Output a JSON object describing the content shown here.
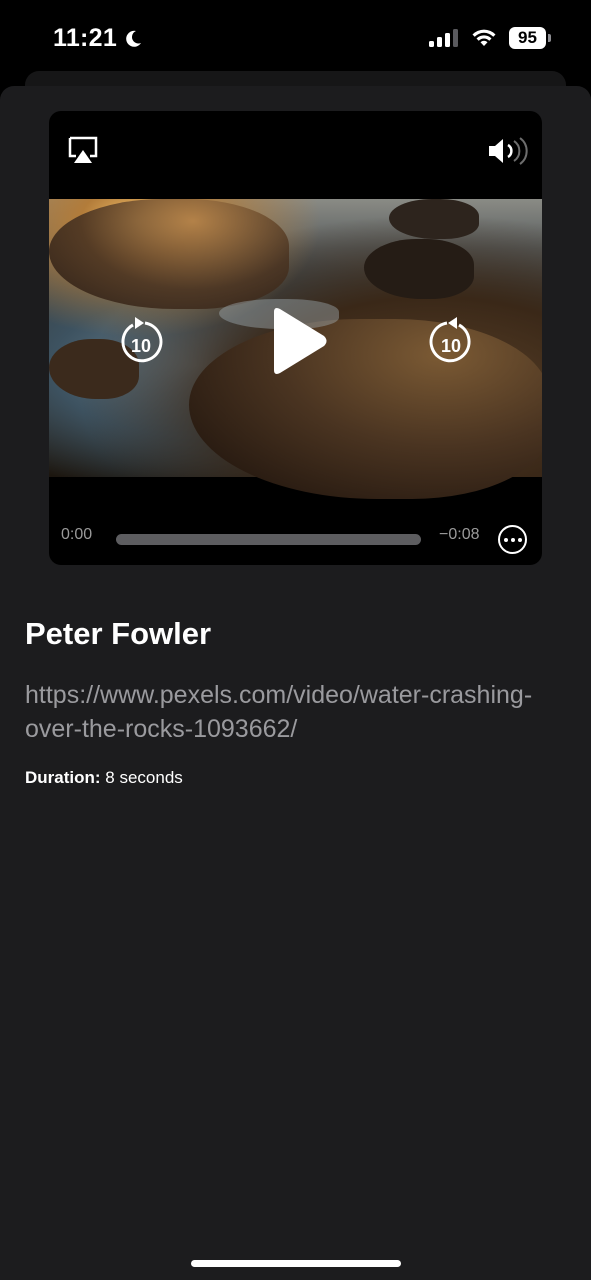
{
  "status": {
    "time": "11:21",
    "battery": "95",
    "icons": [
      "moon-icon",
      "cellular-signal-icon",
      "wifi-icon",
      "battery-icon"
    ]
  },
  "player": {
    "current_time": "0:00",
    "remaining_time": "−0:08",
    "skip_back_seconds": "10",
    "skip_forward_seconds": "10",
    "progress": 0,
    "icons": [
      "airplay-icon",
      "volume-icon",
      "skip-back-10-icon",
      "play-icon",
      "skip-forward-10-icon",
      "more-options-icon"
    ]
  },
  "details": {
    "title": "Peter Fowler",
    "url": "https://www.pexels.com/video/water-crashing-over-the-rocks-1093662/",
    "duration_label": "Duration:",
    "duration_value": "8 seconds"
  },
  "colors": {
    "sheet_background": "#1c1c1e",
    "secondary_text": "#9a9a9e",
    "scrubber_track": "#5d5d60"
  }
}
